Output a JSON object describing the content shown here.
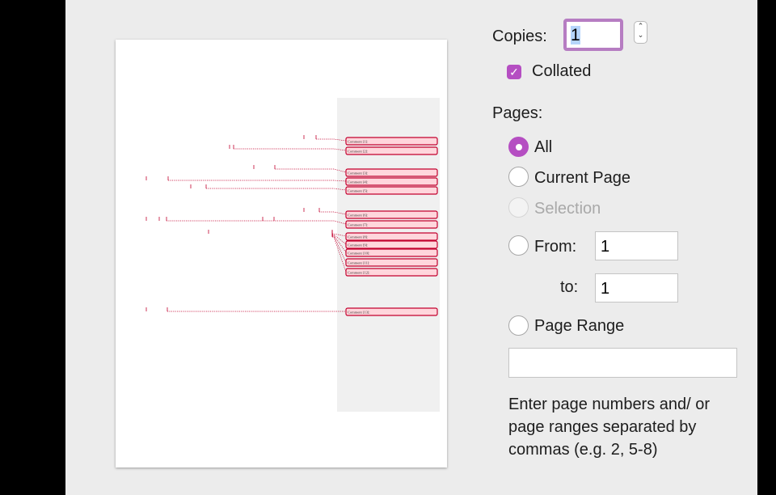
{
  "copies": {
    "label": "Copies:",
    "value": "1"
  },
  "collated": {
    "label": "Collated",
    "checked": true,
    "mark": "✓"
  },
  "stepper": {
    "up": "⌃",
    "down": "⌄"
  },
  "pages": {
    "label": "Pages:",
    "options": [
      {
        "label": "All",
        "selected": true,
        "enabled": true
      },
      {
        "label": "Current Page",
        "selected": false,
        "enabled": true
      },
      {
        "label": "Selection",
        "selected": false,
        "enabled": false
      },
      {
        "label": "From:",
        "selected": false,
        "enabled": true
      },
      {
        "label": "Page Range",
        "selected": false,
        "enabled": true
      }
    ],
    "from_value": "1",
    "to_label": "to:",
    "to_value": "1",
    "range_value": "",
    "help_text": "Enter page numbers and/ or page ranges separated by commas (e.g. 2, 5-8)"
  },
  "preview": {
    "comments": [
      "Comment [1]:",
      "Comment [2]:",
      "Comment [3]:",
      "Comment [4]:",
      "Comment [5]:",
      "Comment [6]:",
      "Comment [7]:",
      "Comment [8]:",
      "Comment [9]:",
      "Comment [10]:",
      "Comment [11]:",
      "Comment [12]:",
      "Comment [13]:"
    ]
  },
  "colors": {
    "accent": "#b54ec2",
    "focus_ring": "#b67dc2",
    "comment_fill": "#ffd6dc",
    "comment_stroke": "#c2002e"
  }
}
